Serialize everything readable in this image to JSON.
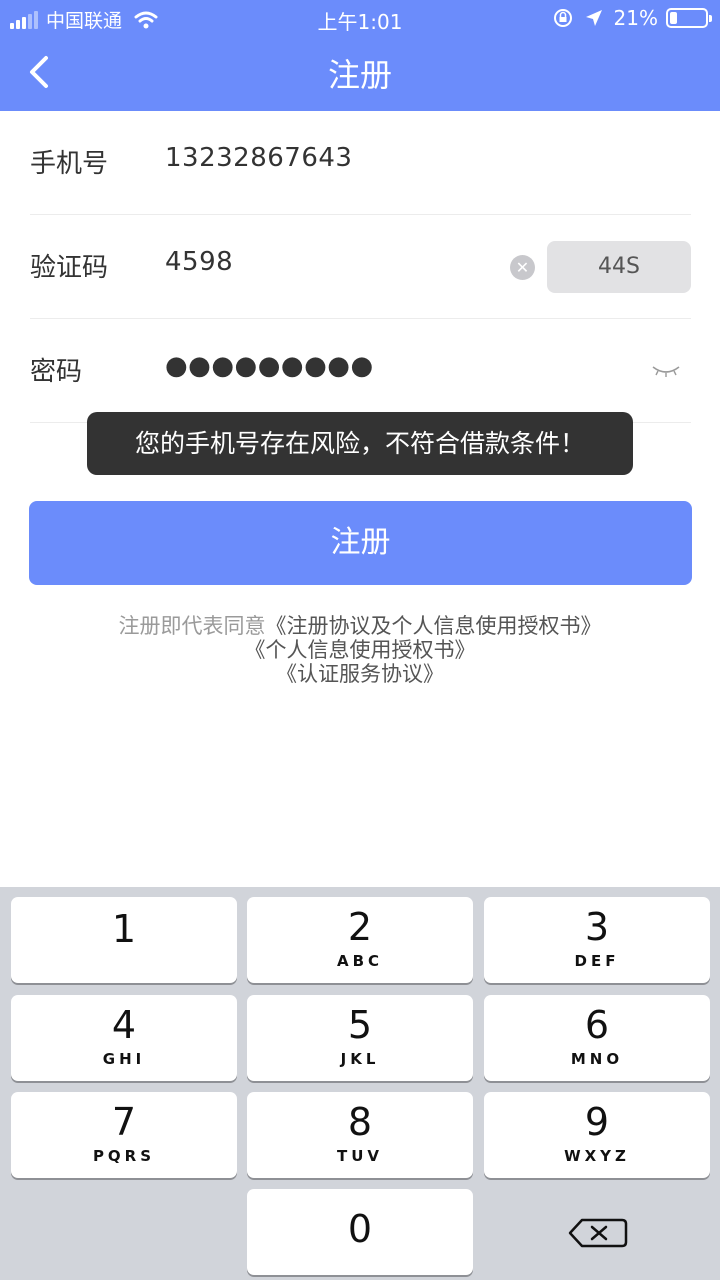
{
  "status_bar": {
    "carrier": "中国联通",
    "time": "上午1:01",
    "battery_percent": "21%",
    "battery_level": 0.21,
    "icons": [
      "signal-icon",
      "wifi-icon",
      "orientation-lock-icon",
      "location-arrow-icon",
      "battery-icon"
    ]
  },
  "nav": {
    "title": "注册",
    "back_icon": "chevron-left-icon"
  },
  "form": {
    "phone": {
      "label": "手机号",
      "value": "13232867643"
    },
    "code": {
      "label": "验证码",
      "value": "4598",
      "clear_icon": "clear-icon",
      "countdown_label": "44S"
    },
    "password": {
      "label": "密码",
      "masked_value": "●●●●●●●●●",
      "visibility_icon": "eye-closed-icon"
    }
  },
  "toast": {
    "message": "您的手机号存在风险，不符合借款条件！"
  },
  "register_button": {
    "label": "注册"
  },
  "agreement": {
    "prefix": "注册即代表同意",
    "link1": "《注册协议及个人信息使用授权书》",
    "link2": "《个人信息使用授权书》",
    "link3": "《认证服务协议》"
  },
  "keypad": {
    "keys": [
      {
        "num": "1",
        "letters": ""
      },
      {
        "num": "2",
        "letters": "ABC"
      },
      {
        "num": "3",
        "letters": "DEF"
      },
      {
        "num": "4",
        "letters": "GHI"
      },
      {
        "num": "5",
        "letters": "JKL"
      },
      {
        "num": "6",
        "letters": "MNO"
      },
      {
        "num": "7",
        "letters": "PQRS"
      },
      {
        "num": "8",
        "letters": "TUV"
      },
      {
        "num": "9",
        "letters": "WXYZ"
      },
      {
        "num": "0",
        "letters": ""
      }
    ],
    "delete_icon": "backspace-icon"
  },
  "colors": {
    "brand": "#6b8cfb",
    "toast_bg": "#333333",
    "keyboard_bg": "#d1d4da"
  }
}
